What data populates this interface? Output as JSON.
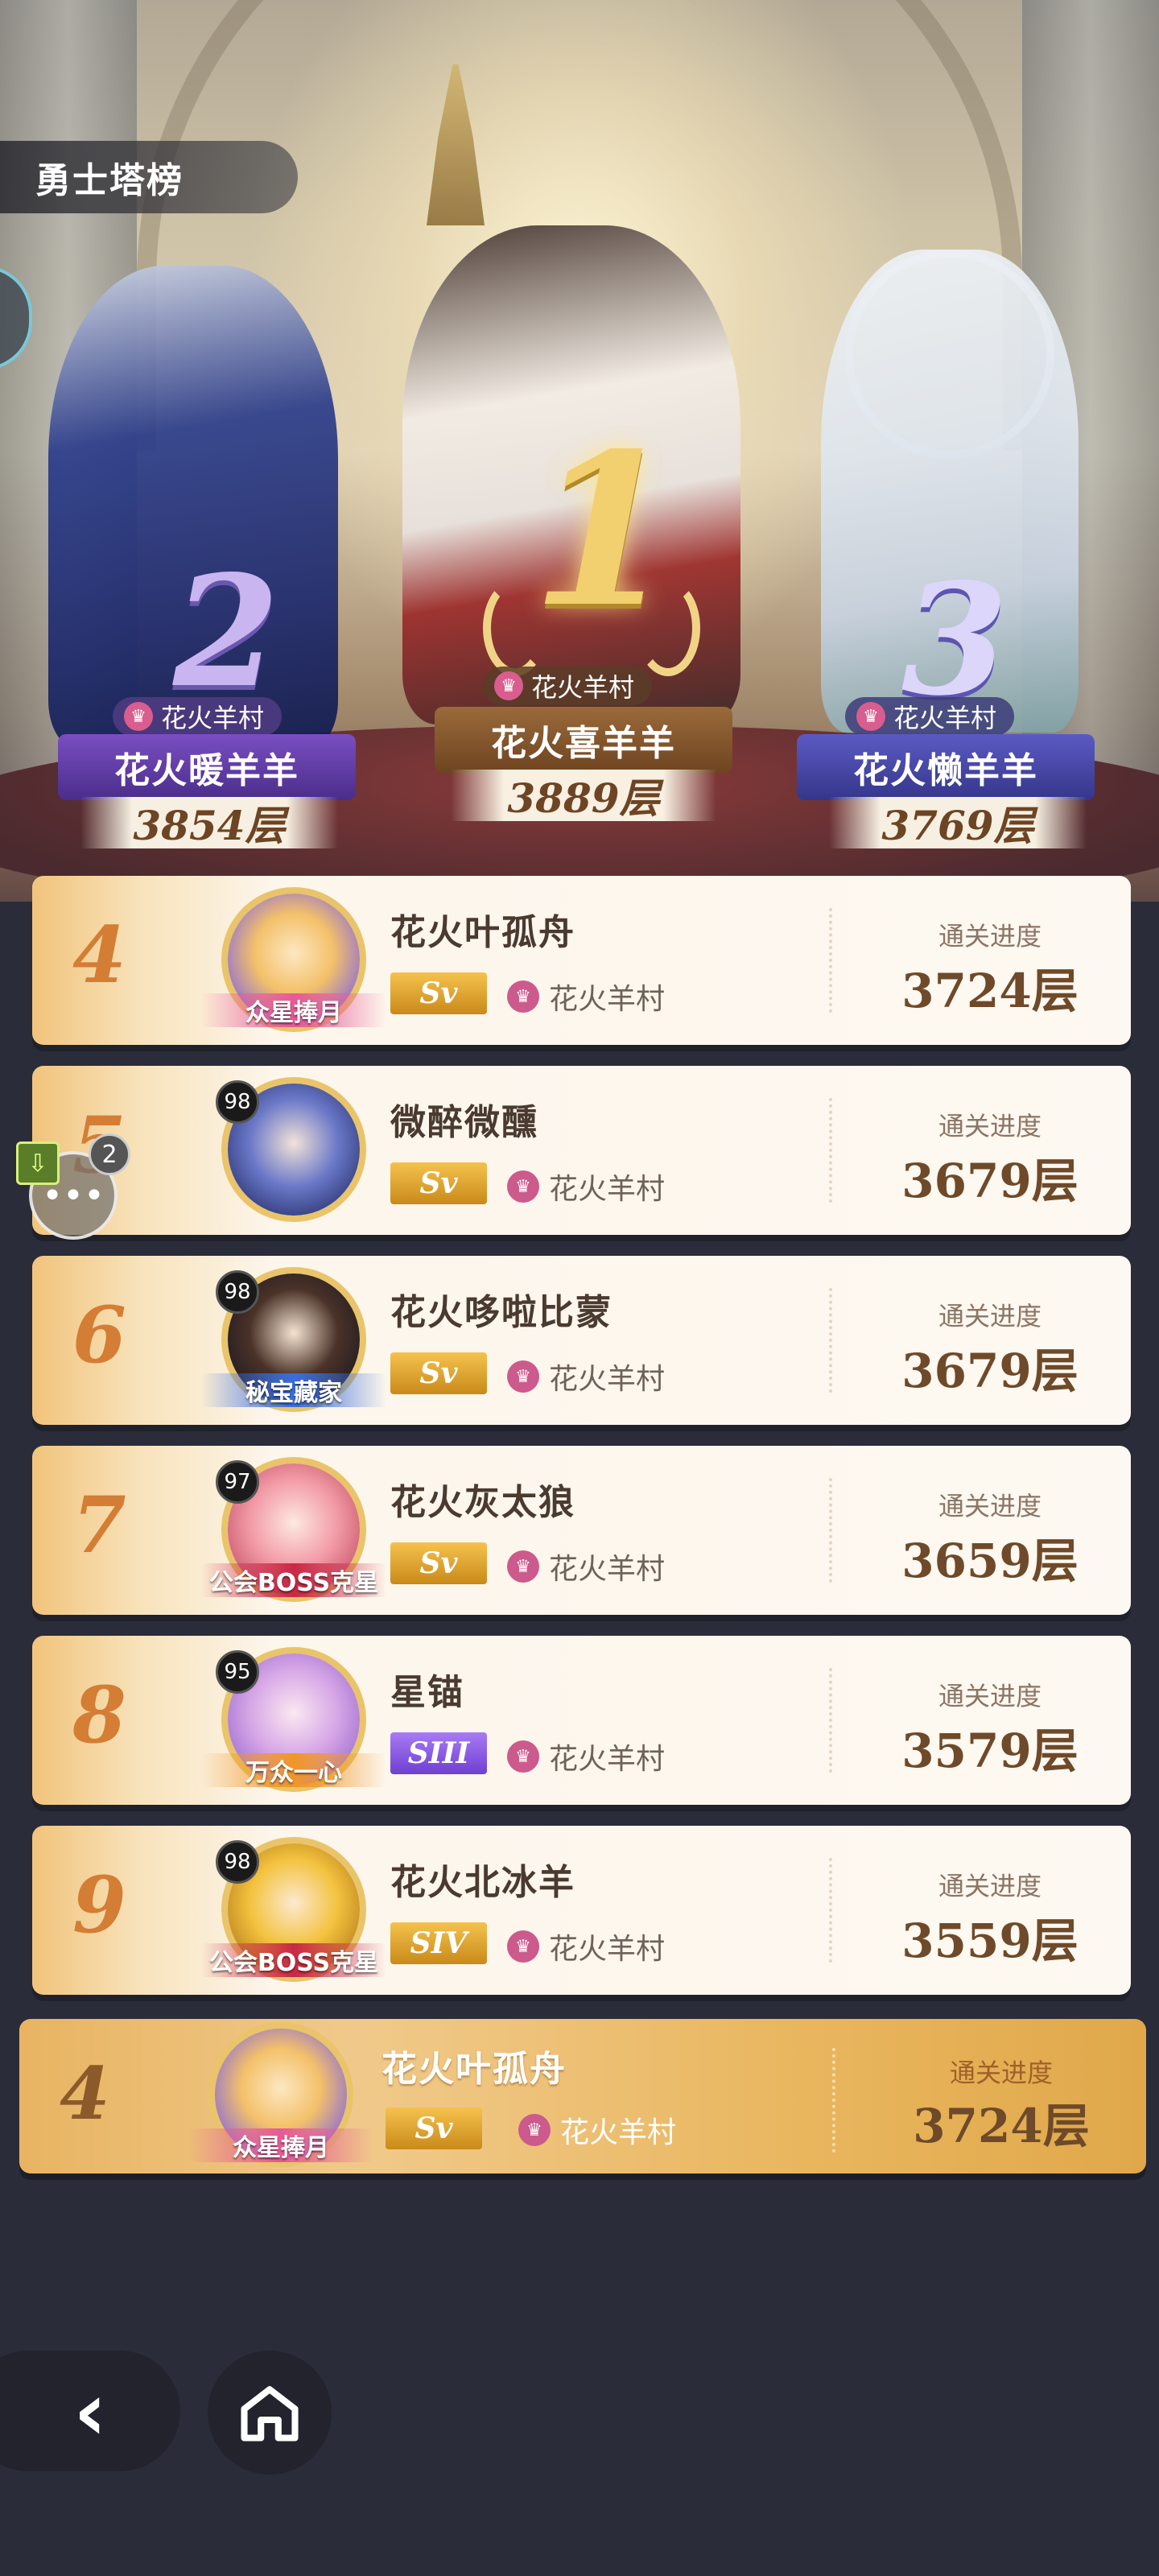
{
  "header": {
    "title": "勇士塔榜"
  },
  "podium": [
    {
      "rank": "1",
      "guild": "花火羊村",
      "name": "花火喜羊羊",
      "score": "3889层"
    },
    {
      "rank": "2",
      "guild": "花火羊村",
      "name": "花火暖羊羊",
      "score": "3854层"
    },
    {
      "rank": "3",
      "guild": "花火羊村",
      "name": "花火懒羊羊",
      "score": "3769层"
    }
  ],
  "list": {
    "progress_label": "通关进度",
    "rows": [
      {
        "rank": "4",
        "level": "",
        "badge": "众星捧月",
        "name": "花火叶孤舟",
        "tier": "Sv",
        "guild": "花火羊村",
        "progress": "3724层"
      },
      {
        "rank": "5",
        "level": "98",
        "badge": "",
        "name": "微醉微醺",
        "tier": "Sv",
        "guild": "花火羊村",
        "progress": "3679层"
      },
      {
        "rank": "6",
        "level": "98",
        "badge": "秘宝藏家",
        "name": "花火哆啦比蒙",
        "tier": "Sv",
        "guild": "花火羊村",
        "progress": "3679层"
      },
      {
        "rank": "7",
        "level": "97",
        "badge": "公会BOSS克星",
        "name": "花火灰太狼",
        "tier": "Sv",
        "guild": "花火羊村",
        "progress": "3659层"
      },
      {
        "rank": "8",
        "level": "95",
        "badge": "万众一心",
        "name": "星锚",
        "tier": "SIII",
        "guild": "花火羊村",
        "progress": "3579层"
      },
      {
        "rank": "9",
        "level": "98",
        "badge": "公会BOSS克星",
        "name": "花火北冰羊",
        "tier": "SIV",
        "guild": "花火羊村",
        "progress": "3559层"
      }
    ]
  },
  "my_rank": {
    "rank": "4",
    "badge": "众星捧月",
    "name": "花火叶孤舟",
    "tier": "Sv",
    "guild": "花火羊村",
    "progress_label": "通关进度",
    "progress": "3724层"
  },
  "chat": {
    "unread_count": "2"
  },
  "colors": {
    "accent_orange": "#d47d35",
    "tier_gold": "#f5c24d",
    "tier_purple": "#8a5be3",
    "guild_crown": "#cc5a8c"
  },
  "icons": {
    "back": "chevron-left-icon",
    "home": "home-icon",
    "chat": "chat-bubble-icon",
    "crown": "crown-icon"
  }
}
